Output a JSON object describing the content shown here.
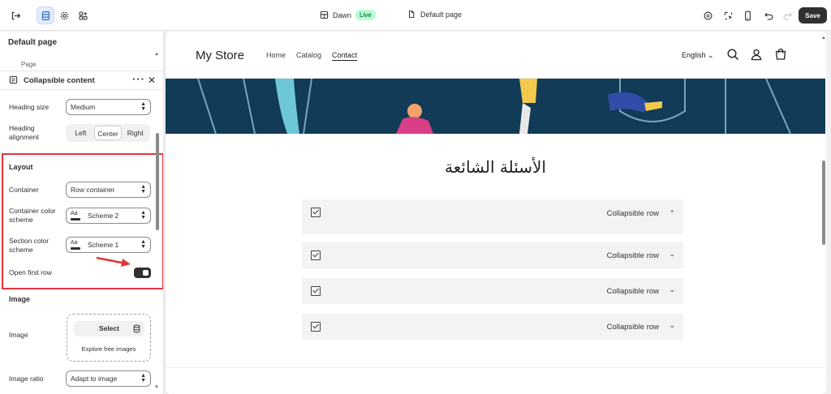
{
  "topbar": {
    "theme_name": "Dawn",
    "live_badge": "Live",
    "page_name": "Default page",
    "save_label": "Save"
  },
  "panel": {
    "title": "Default page",
    "page_item": "Page",
    "block_title": "Collapsible content",
    "heading_size_label": "Heading size",
    "heading_size_value": "Medium",
    "heading_alignment_label_1": "Heading",
    "heading_alignment_label_2": "alignment",
    "alignment_options": [
      "Left",
      "Center",
      "Right"
    ],
    "alignment_selected": "Center",
    "layout_header": "Layout",
    "container_label": "Container",
    "container_value": "Row container",
    "container_scheme_label_1": "Container color",
    "container_scheme_label_2": "scheme",
    "container_scheme_value": "Scheme 2",
    "section_scheme_label_1": "Section color",
    "section_scheme_label_2": "scheme",
    "section_scheme_value": "Scheme 1",
    "swatch_text": "Aa",
    "open_first_row_label": "Open first row",
    "open_first_row": true,
    "image_header": "Image",
    "image_label": "Image",
    "image_select": "Select",
    "explore_images": "Explore free images",
    "image_ratio_label": "Image ratio",
    "image_ratio_value": "Adapt to image"
  },
  "preview": {
    "store_name": "My Store",
    "nav": [
      "Home",
      "Catalog",
      "Contact"
    ],
    "nav_active": "Contact",
    "language": "English",
    "faq_heading": "الأسئلة الشائعة",
    "rows": [
      {
        "label": "Collapsible row",
        "open": true
      },
      {
        "label": "Collapsible row",
        "open": false
      },
      {
        "label": "Collapsible row",
        "open": false
      },
      {
        "label": "Collapsible row",
        "open": false
      }
    ]
  },
  "colors": {
    "accent_red": "#e0363b",
    "hero_bg": "#113b57",
    "live_badge_bg": "#b4fed2",
    "row_bg": "#f3f3f3"
  }
}
